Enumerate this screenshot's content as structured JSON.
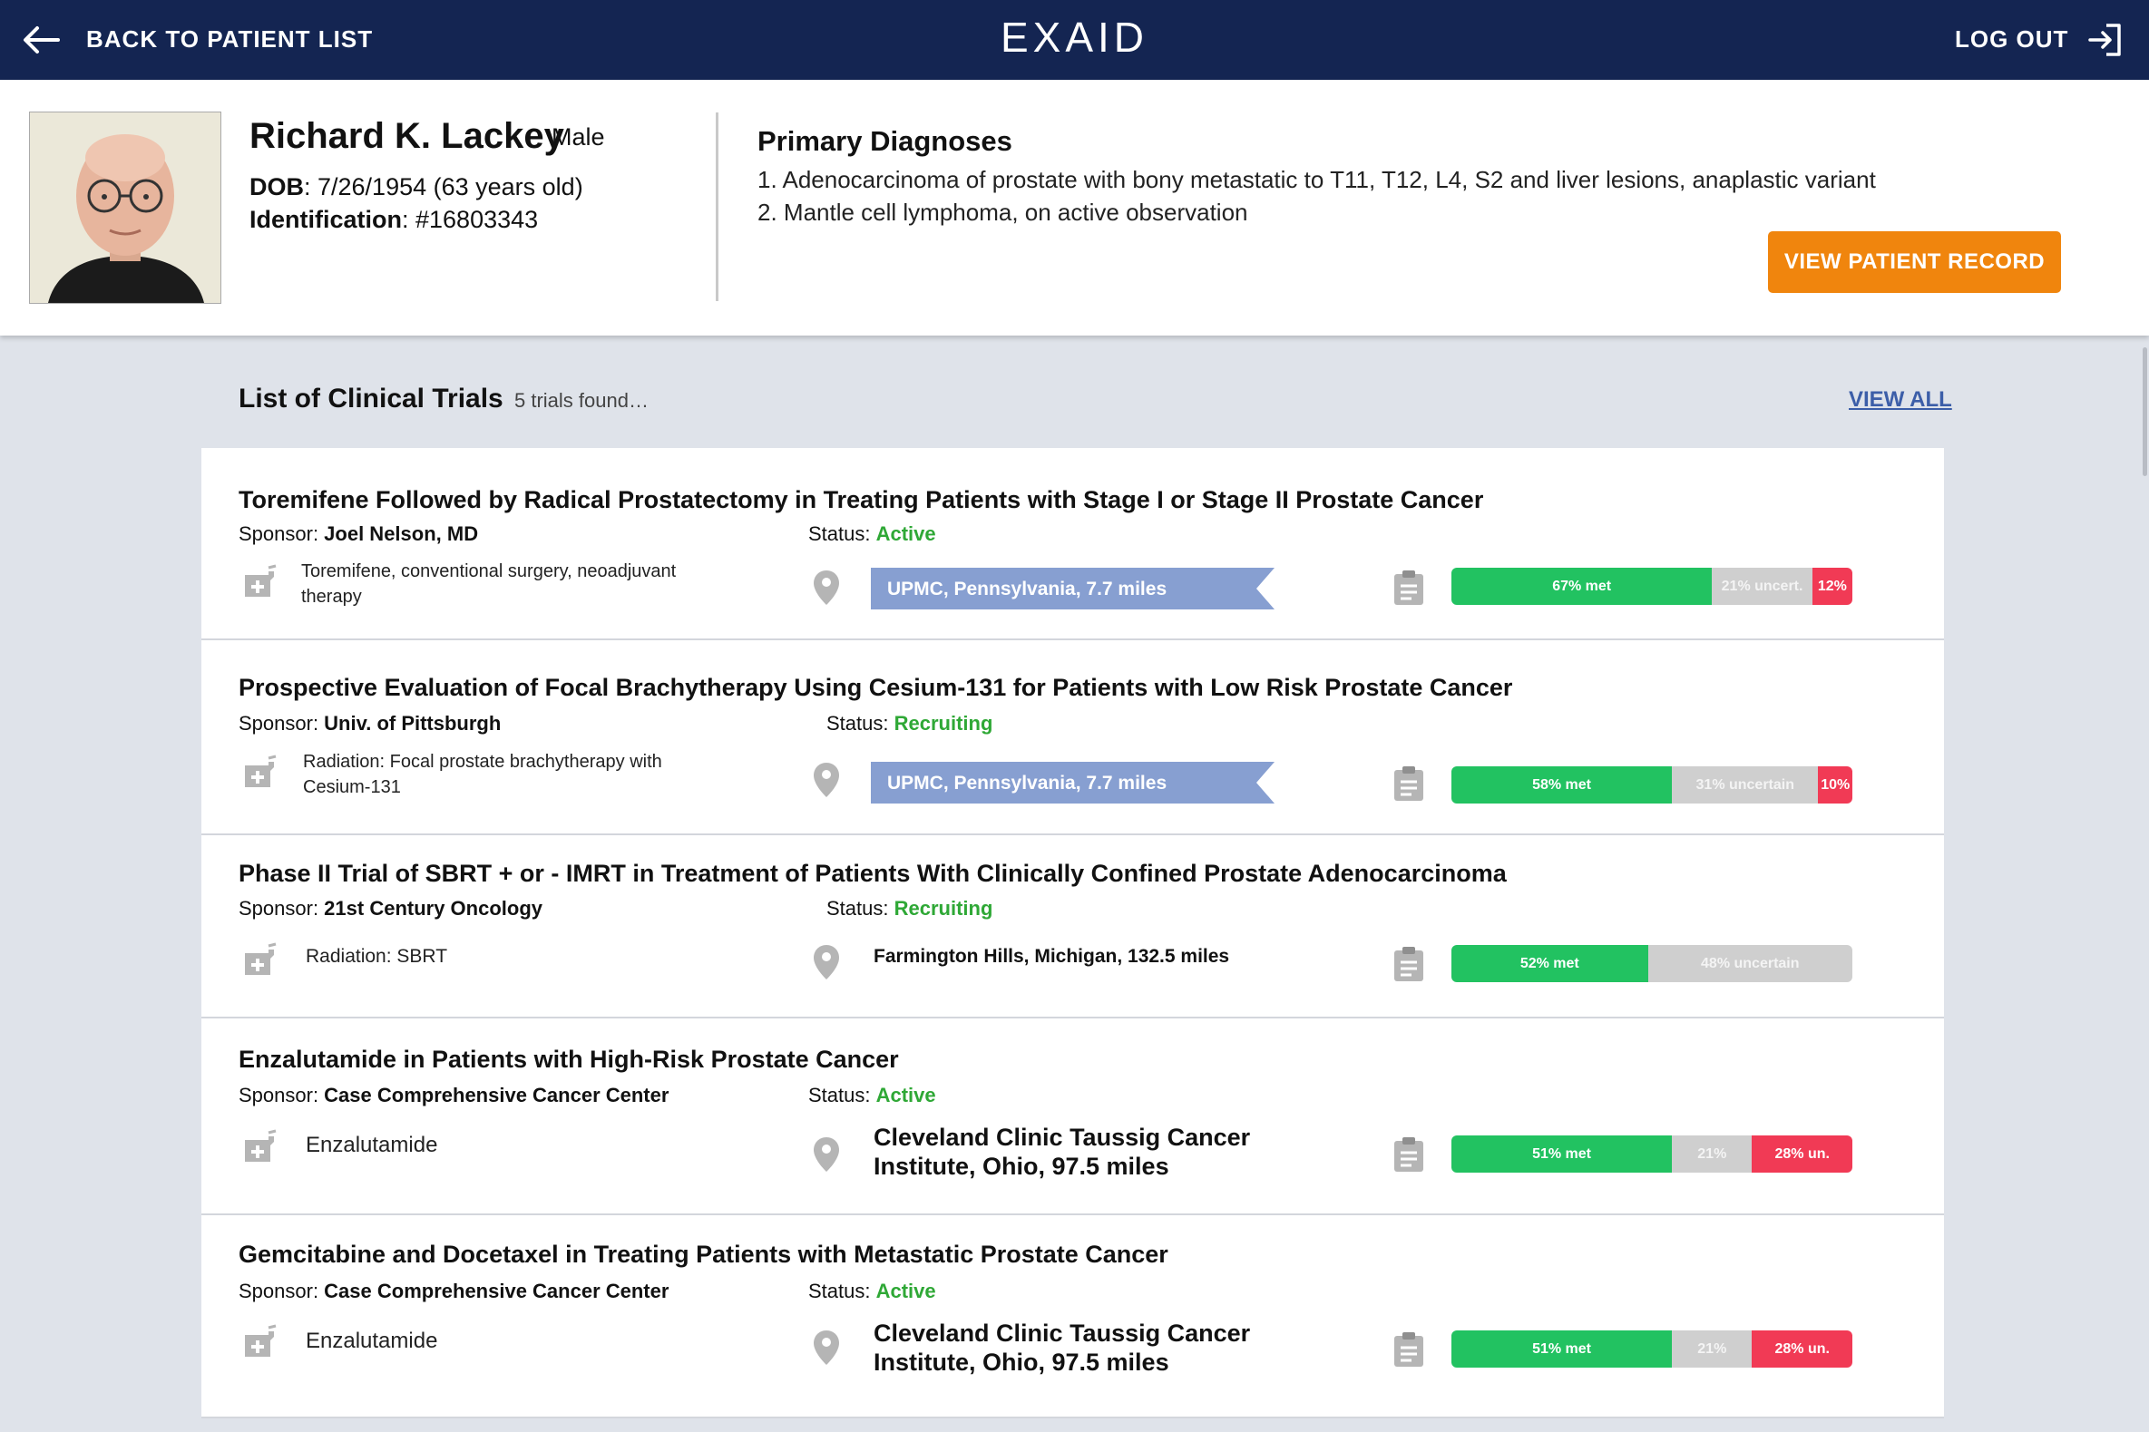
{
  "nav": {
    "back_label": "BACK TO PATIENT LIST",
    "logo": "EXAID",
    "logout_label": "LOG OUT"
  },
  "patient": {
    "name": "Richard K. Lackey",
    "sex": "Male",
    "dob_label": "DOB",
    "dob_value": ": 7/26/1954 (63 years old)",
    "id_label": "Identification",
    "id_value": ": #16803343"
  },
  "diagnoses": {
    "title": "Primary Diagnoses",
    "items": [
      "1. Adenocarcinoma of prostate with bony metastatic to T11, T12, L4, S2 and liver lesions, anaplastic variant",
      "2. Mantle cell lymphoma, on active observation"
    ],
    "view_record_label": "VIEW PATIENT RECORD"
  },
  "trials_header": {
    "title": "List of Clinical Trials",
    "count_text": "5 trials found…",
    "view_all_label": "VIEW ALL"
  },
  "colors": {
    "met": "#22c261",
    "uncertain": "#cfcfcf",
    "unmet": "#f13a55",
    "status": "#2fa836",
    "accent": "#f0850d",
    "nav_bg": "#142552",
    "location_flag": "#879fd1"
  },
  "trials": [
    {
      "title": "Toremifene Followed by Radical Prostatectomy in Treating Patients with Stage I or Stage II Prostate Cancer",
      "sponsor_label": "Sponsor: ",
      "sponsor": "Joel Nelson, MD",
      "status_label": "Status: ",
      "status": "Active",
      "interventions": "Toremifene, conventional surgery, neoadjuvant therapy",
      "location": "UPMC, Pennsylvania, 7.7 miles",
      "criteria": [
        {
          "kind": "met",
          "label": "67% met",
          "fraction": 0.65
        },
        {
          "kind": "uncertain",
          "label": "21% uncert.",
          "fraction": 0.25
        },
        {
          "kind": "unmet",
          "label": "12%",
          "fraction": 0.1
        }
      ]
    },
    {
      "title": "Prospective Evaluation of Focal Brachytherapy Using Cesium-131 for Patients with Low Risk Prostate Cancer",
      "sponsor_label": "Sponsor: ",
      "sponsor": "Univ. of Pittsburgh",
      "status_label": "Status: ",
      "status": "Recruiting",
      "interventions": "Radiation: Focal prostate brachytherapy with Cesium-131",
      "location": "UPMC, Pennsylvania, 7.7 miles",
      "criteria": [
        {
          "kind": "met",
          "label": "58% met",
          "fraction": 0.55
        },
        {
          "kind": "uncertain",
          "label": "31% uncertain",
          "fraction": 0.365
        },
        {
          "kind": "unmet",
          "label": "10%",
          "fraction": 0.085
        }
      ]
    },
    {
      "title": "Phase II Trial of SBRT + or - IMRT in Treatment of Patients With Clinically Confined Prostate Adenocarcinoma",
      "sponsor_label": "Sponsor: ",
      "sponsor": "21st Century Oncology",
      "status_label": "Status: ",
      "status": "Recruiting",
      "interventions": "Radiation: SBRT",
      "location": "Farmington Hills, Michigan, 132.5 miles",
      "criteria": [
        {
          "kind": "met",
          "label": "52% met",
          "fraction": 0.49
        },
        {
          "kind": "uncertain",
          "label": "48% uncertain",
          "fraction": 0.51
        }
      ]
    },
    {
      "title": "Enzalutamide in Patients with High-Risk Prostate Cancer",
      "sponsor_label": "Sponsor: ",
      "sponsor": "Case Comprehensive Cancer Center",
      "status_label": "Status: ",
      "status": "Active",
      "interventions": "Enzalutamide",
      "location": "Cleveland Clinic Taussig Cancer Institute, Ohio, 97.5 miles",
      "criteria": [
        {
          "kind": "met",
          "label": "51% met",
          "fraction": 0.55
        },
        {
          "kind": "uncertain",
          "label": "21%",
          "fraction": 0.2
        },
        {
          "kind": "unmet",
          "label": "28% un.",
          "fraction": 0.25
        }
      ]
    },
    {
      "title": "Gemcitabine and Docetaxel in Treating Patients with Metastatic Prostate Cancer",
      "sponsor_label": "Sponsor: ",
      "sponsor": "Case Comprehensive Cancer Center",
      "status_label": "Status: ",
      "status": "Active",
      "interventions": "Enzalutamide",
      "location": "Cleveland Clinic Taussig Cancer Institute, Ohio, 97.5 miles",
      "criteria": [
        {
          "kind": "met",
          "label": "51% met",
          "fraction": 0.55
        },
        {
          "kind": "uncertain",
          "label": "21%",
          "fraction": 0.2
        },
        {
          "kind": "unmet",
          "label": "28% un.",
          "fraction": 0.25
        }
      ]
    }
  ]
}
